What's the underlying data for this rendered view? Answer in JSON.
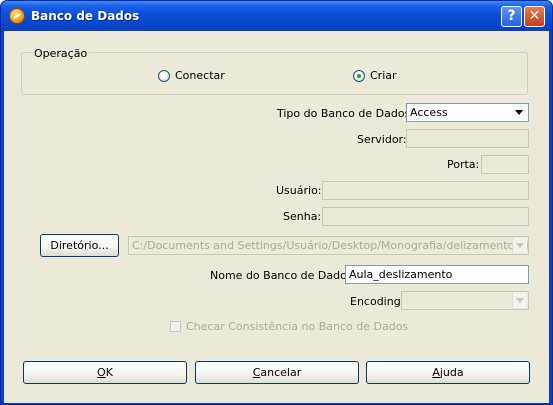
{
  "window": {
    "title": "Banco de Dados",
    "help_icon": "?",
    "close_icon": "✕"
  },
  "operation": {
    "legend": "Operação",
    "options": [
      {
        "label": "Conectar",
        "checked": false
      },
      {
        "label": "Criar",
        "checked": true
      }
    ]
  },
  "form": {
    "db_type_label": "Tipo do Banco de Dados:",
    "db_type_value": "Access",
    "server_label": "Servidor:",
    "server_value": "",
    "port_label": "Porta:",
    "port_value": "",
    "user_label": "Usuário:",
    "user_value": "",
    "password_label": "Senha:",
    "password_value": "",
    "directory_button": "Diretório...",
    "directory_value": "C:/Documents and Settings/Usuário/Desktop/Monografia/delizamento_viçosa",
    "db_name_label": "Nome do Banco de Dados:",
    "db_name_value": "Aula_deslizamento",
    "encoding_label": "Encoding",
    "encoding_value": "",
    "consistency_label": "Checar Consistência no Banco de Dados",
    "consistency_checked": false
  },
  "buttons": {
    "ok_first": "O",
    "ok_rest": "K",
    "cancel_first": "C",
    "cancel_rest": "ancelar",
    "help_first": "A",
    "help_rest": "juda"
  }
}
